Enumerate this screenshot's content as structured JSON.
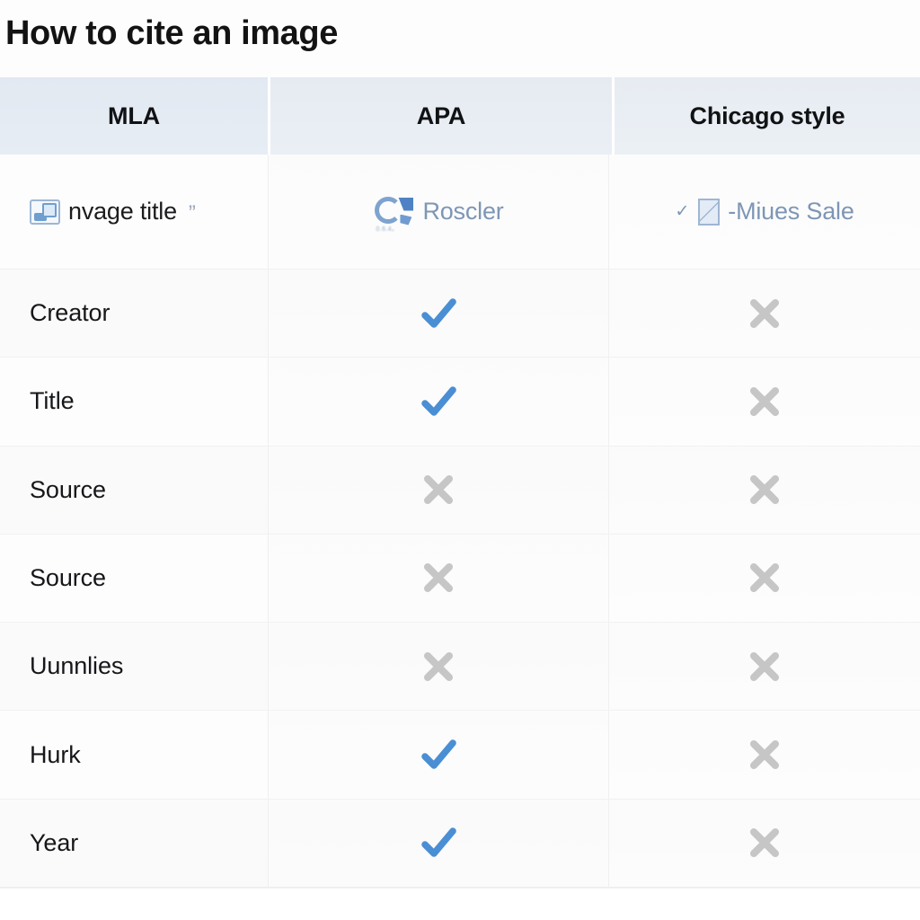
{
  "page": {
    "title": "How to cite an image",
    "background_color": "#fdfdfd"
  },
  "colors": {
    "header_background": "#e5ebf3",
    "check_blue": "#4a8ed4",
    "cross_gray": "#c6c6c6",
    "title_text": "#131313",
    "row_label_text": "#16171a",
    "artifact_text_blue": "#7f8fa6"
  },
  "table": {
    "columns": [
      {
        "id": "mla",
        "label": "MLA"
      },
      {
        "id": "apa",
        "label": "APA"
      },
      {
        "id": "chicago",
        "label": "Chicago style"
      }
    ],
    "artifact_row": {
      "mla": {
        "icon": "photo-placeholder-icon",
        "text": "nvage title",
        "trailing_quote": "”"
      },
      "apa": {
        "icon": "circular-logo-icon",
        "icon_microtext": "0.6.4₂",
        "text": "Roscler"
      },
      "chicago": {
        "icon": "small-check-icon",
        "icon2": "square-placeholder-icon",
        "text": "-Miues Sale"
      }
    },
    "rows": [
      {
        "label": "Creator",
        "mla": "",
        "apa": "check",
        "chicago": "cross"
      },
      {
        "label": "Title",
        "mla": "",
        "apa": "check",
        "chicago": "cross"
      },
      {
        "label": "Source",
        "mla": "",
        "apa": "cross",
        "chicago": "cross"
      },
      {
        "label": "Source",
        "mla": "",
        "apa": "cross",
        "chicago": "cross"
      },
      {
        "label": "Uunnlies",
        "mla": "",
        "apa": "cross",
        "chicago": "cross"
      },
      {
        "label": "Hurk",
        "mla": "",
        "apa": "check",
        "chicago": "cross"
      },
      {
        "label": "Year",
        "mla": "",
        "apa": "check",
        "chicago": "cross"
      }
    ]
  }
}
